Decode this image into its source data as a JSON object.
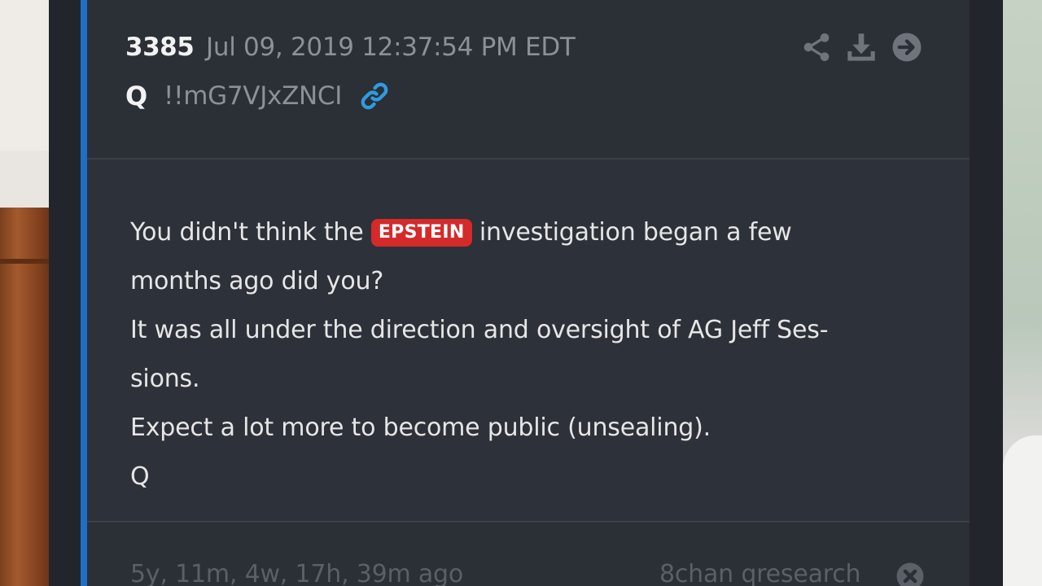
{
  "post": {
    "number": "3385",
    "date": "Jul 09, 2019 12:37:54 PM EDT",
    "author": "Q",
    "tripcode": "!!mG7VJxZNCI",
    "tag": "EPSTEIN",
    "lines": {
      "line1_before": "You didn't think the",
      "line1_after": "investigation began a few",
      "line2": "months ago did you?",
      "line3": "It was all under the direction and oversight of AG Jeff Ses-",
      "line4": "sions.",
      "line5": "Expect a lot more to become public (unsealing).",
      "line6": "Q"
    }
  },
  "footer": {
    "time_ago": "5y, 11m, 4w, 17h, 39m ago",
    "source": "8chan qresearch"
  },
  "icons": {
    "link": "link-icon",
    "share": "share-icon",
    "download": "download-icon",
    "forward": "arrow-right-circle-icon",
    "close": "close-circle-icon"
  },
  "colors": {
    "accent": "#1f6fc6",
    "tag_background": "#d42a2a",
    "link_icon": "#2f9be0"
  }
}
